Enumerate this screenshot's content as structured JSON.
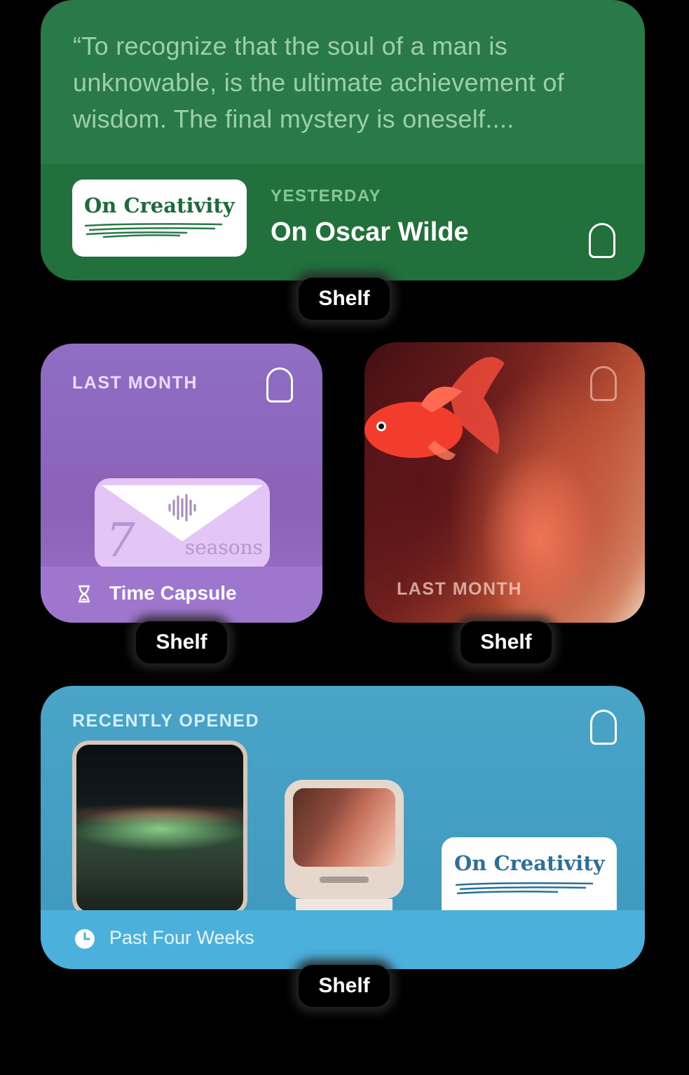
{
  "quote_widget": {
    "quote": "“To recognize that the soul of a man is unknowable, is the ultimate achievement of wisdom. The final mystery is oneself....",
    "thumbnail_title": "On Creativity",
    "date_label": "YESTERDAY",
    "entry_title": "On Oscar Wilde",
    "icon": "shelf-icon"
  },
  "capsule_widget": {
    "period": "LAST MONTH",
    "envelope_number": "7",
    "envelope_word": "seasons",
    "footer_label": "Time Capsule",
    "footer_icon": "hourglass-icon"
  },
  "photo_widget": {
    "period": "LAST MONTH"
  },
  "recent_widget": {
    "header": "RECENTLY OPENED",
    "card_title": "On Creativity",
    "footer_label": "Past Four Weeks",
    "footer_icon": "clock-icon"
  },
  "shelf_labels": [
    "Shelf",
    "Shelf",
    "Shelf",
    "Shelf"
  ],
  "colors": {
    "quote_bg": "#2a7a47",
    "capsule_bg": "#8f6ec4",
    "recent_bg": "#4aa4c8"
  }
}
